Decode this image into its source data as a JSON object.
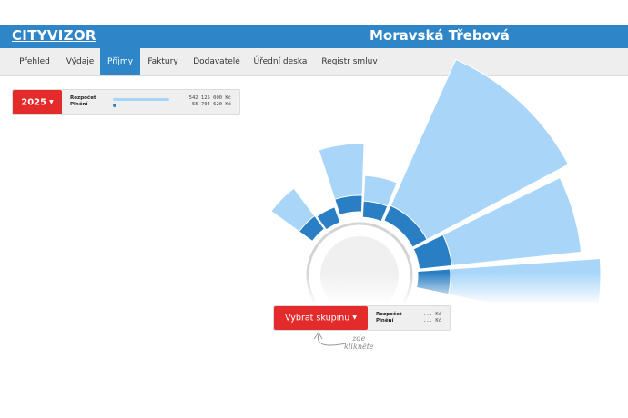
{
  "header": {
    "logo": "CITYVIZOR",
    "city": "Moravská Třebová"
  },
  "nav": {
    "tabs": [
      "Přehled",
      "Výdaje",
      "Příjmy",
      "Faktury",
      "Dodavatelé",
      "Úřední deska",
      "Registr smluv"
    ],
    "active": "Příjmy"
  },
  "budget": {
    "year": "2025",
    "rozpocet_label": "Rozpočet",
    "rozpocet_value": "542 125 000 Kč",
    "plneni_label": "Plnění",
    "plneni_value": "55 704 620 Kč",
    "plneni_fraction": 0.103
  },
  "group": {
    "button": "Vybrat skupinu",
    "rozpocet_label": "Rozpočet",
    "rozpocet_value": "... Kč",
    "plneni_label": "Plnění",
    "plneni_value": "... Kč"
  },
  "hint": {
    "line1": "zde",
    "line2": "klikněte"
  },
  "colors": {
    "header": "#2e86c9",
    "accent_red": "#e32b2b",
    "budget_fill": "#a9d6f8",
    "spent_fill": "#2a7fc4"
  }
}
